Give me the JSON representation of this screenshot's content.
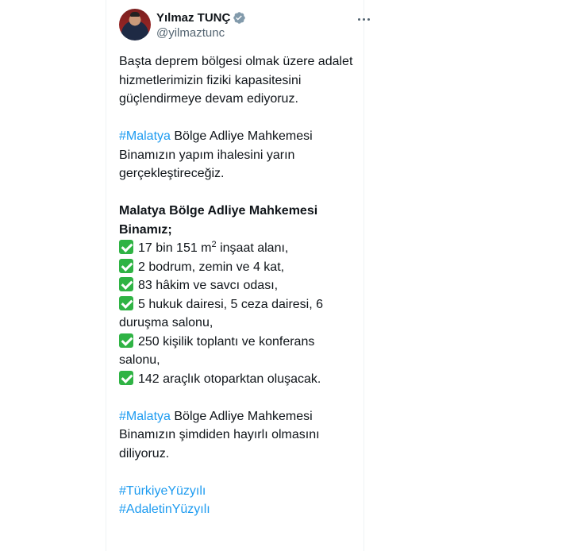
{
  "author": {
    "display_name": "Yılmaz TUNÇ",
    "handle": "@yilmaztunc",
    "verified_icon": "verified-badge-icon",
    "verified_color": "#829aab"
  },
  "more_icon": "more-options-icon",
  "colors": {
    "hashtag": "#1d9bf0",
    "check": "#2fb344",
    "text": "#0f1419",
    "muted": "#536471"
  },
  "tweet": {
    "p1": "Başta deprem bölgesi olmak üzere adalet hizmetlerimizin fiziki kapasitesini güçlendirmeye devam ediyoruz.",
    "p2_hashtag": "#Malatya",
    "p2_text": " Bölge Adliye Mahkemesi Binamızın yapım ihalesini yarın gerçekleştireceğiz.",
    "p3_title": "Malatya Bölge Adliye Mahkemesi Binamız;",
    "items": [
      {
        "pre": "17 bin 151 m",
        "sup": "2",
        "post": " inşaat alanı,"
      },
      {
        "text": "2 bodrum, zemin ve 4 kat,"
      },
      {
        "text": "83 hâkim ve savcı odası,"
      },
      {
        "text": "5 hukuk dairesi, 5 ceza dairesi, 6 duruşma salonu,"
      },
      {
        "text": "250 kişilik toplantı ve konferans salonu,"
      },
      {
        "text": "142 araçlık otoparktan oluşacak."
      }
    ],
    "p4_hashtag": "#Malatya",
    "p4_text": " Bölge Adliye Mahkemesi Binamızın şimdiden hayırlı olmasını diliyoruz.",
    "hashtag1": "#TürkiyeYüzyılı",
    "hashtag2": "#AdaletinYüzyılı"
  }
}
